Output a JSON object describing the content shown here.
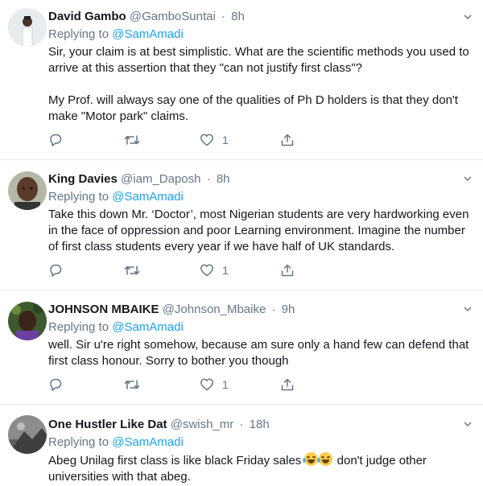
{
  "tweets": [
    {
      "name": "David Gambo",
      "handle": "@GamboSuntai",
      "time": "8h",
      "replying_prefix": "Replying to",
      "replying_to": "@SamAmadi",
      "paragraphs": [
        "Sir, your claim is at best simplistic. What are the scientific methods you used to arrive at this assertion that they \"can not justify first class\"?",
        "My Prof. will always say one of the qualities of Ph D holders is that they don't make \"Motor park\" claims."
      ],
      "likes": "1"
    },
    {
      "name": "King Davies",
      "handle": "@iam_Daposh",
      "time": "8h",
      "replying_prefix": "Replying to",
      "replying_to": "@SamAmadi",
      "paragraphs": [
        "Take this down Mr. ‘Doctor’, most Nigerian students are very hardworking even in the face of oppression and poor Learning environment. Imagine the number of first class students every year if we have half of UK standards."
      ],
      "likes": "1"
    },
    {
      "name": "JOHNSON MBAIKE",
      "handle": "@Johnson_Mbaike",
      "time": "9h",
      "replying_prefix": "Replying to",
      "replying_to": "@SamAmadi",
      "paragraphs": [
        "well. Sir u're right somehow, because am sure only a hand few can defend that first class honour. Sorry to bother you though"
      ],
      "likes": "1"
    },
    {
      "name": "One Hustler Like Dat",
      "handle": "@swish_mr",
      "time": "18h",
      "replying_prefix": "Replying to",
      "replying_to": "@SamAmadi",
      "text_before_emoji": "Abeg Unilag first class is like black Friday sales",
      "emoji_name": "face-with-tears-of-joy-emoji",
      "text_after_emoji": "don't judge other universities with that abeg."
    }
  ],
  "separator": "·",
  "colors": {
    "text": "#14171a",
    "secondary": "#657786",
    "link": "#1da1f2",
    "divider": "#e6ecf0"
  },
  "icons": [
    "reply-icon",
    "retweet-icon",
    "like-icon",
    "share-icon",
    "chevron-down-icon"
  ]
}
